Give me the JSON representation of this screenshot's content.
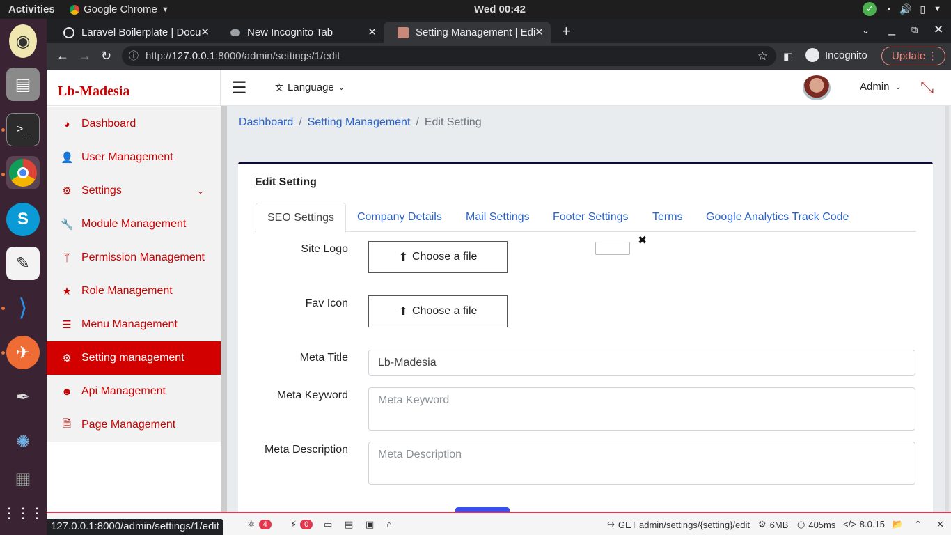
{
  "os": {
    "activities": "Activities",
    "app_name": "Google Chrome",
    "clock": "Wed 00:42"
  },
  "browser": {
    "tabs": [
      {
        "label": "Laravel Boilerplate | Docu"
      },
      {
        "label": "New Incognito Tab"
      },
      {
        "label": "Setting Management | Edi"
      }
    ],
    "url_prefix": "http://",
    "url_host": "127.0.0.1",
    "url_rest": ":8000/admin/settings/1/edit",
    "incognito_label": "Incognito",
    "update_label": "Update",
    "status_url": "127.0.0.1:8000/admin/settings/1/edit"
  },
  "app": {
    "brand": "Lb-Madesia",
    "language_label": "Language",
    "user_label": "Admin"
  },
  "sidebar": {
    "items": [
      {
        "label": "Dashboard",
        "icon": "tachometer-icon"
      },
      {
        "label": "User Management",
        "icon": "user-icon"
      },
      {
        "label": "Settings",
        "icon": "cogs-icon"
      },
      {
        "label": "Module Management",
        "icon": "wrench-icon"
      },
      {
        "label": "Permission Management",
        "icon": "fork-icon"
      },
      {
        "label": "Role Management",
        "icon": "star-icon"
      },
      {
        "label": "Menu Management",
        "icon": "bars-icon"
      },
      {
        "label": "Setting management",
        "icon": "gear-icon"
      },
      {
        "label": "Api Management",
        "icon": "reddit-icon"
      },
      {
        "label": "Page Management",
        "icon": "file-icon"
      }
    ]
  },
  "breadcrumb": {
    "items": [
      "Dashboard",
      "Setting Management",
      "Edit Setting"
    ],
    "sep": "/"
  },
  "card": {
    "title": "Edit Setting",
    "tabs": [
      "SEO Settings",
      "Company Details",
      "Mail Settings",
      "Footer Settings",
      "Terms",
      "Google Analytics Track Code"
    ]
  },
  "form": {
    "site_logo_label": "Site Logo",
    "fav_icon_label": "Fav Icon",
    "choose_file_label": "Choose a file",
    "meta_title_label": "Meta Title",
    "meta_title_value": "Lb-Madesia",
    "meta_keyword_label": "Meta Keyword",
    "meta_keyword_placeholder": "Meta Keyword",
    "meta_description_label": "Meta Description",
    "meta_description_placeholder": "Meta Description"
  },
  "debugbar": {
    "badge_a": "4",
    "badge_b": "0",
    "route": "GET admin/settings/{setting}/edit",
    "memory": "6MB",
    "time": "405ms",
    "php": "8.0.15"
  },
  "colors": {
    "accent": "#c80000",
    "active_nav": "#d30000",
    "link": "#2a62c9"
  }
}
